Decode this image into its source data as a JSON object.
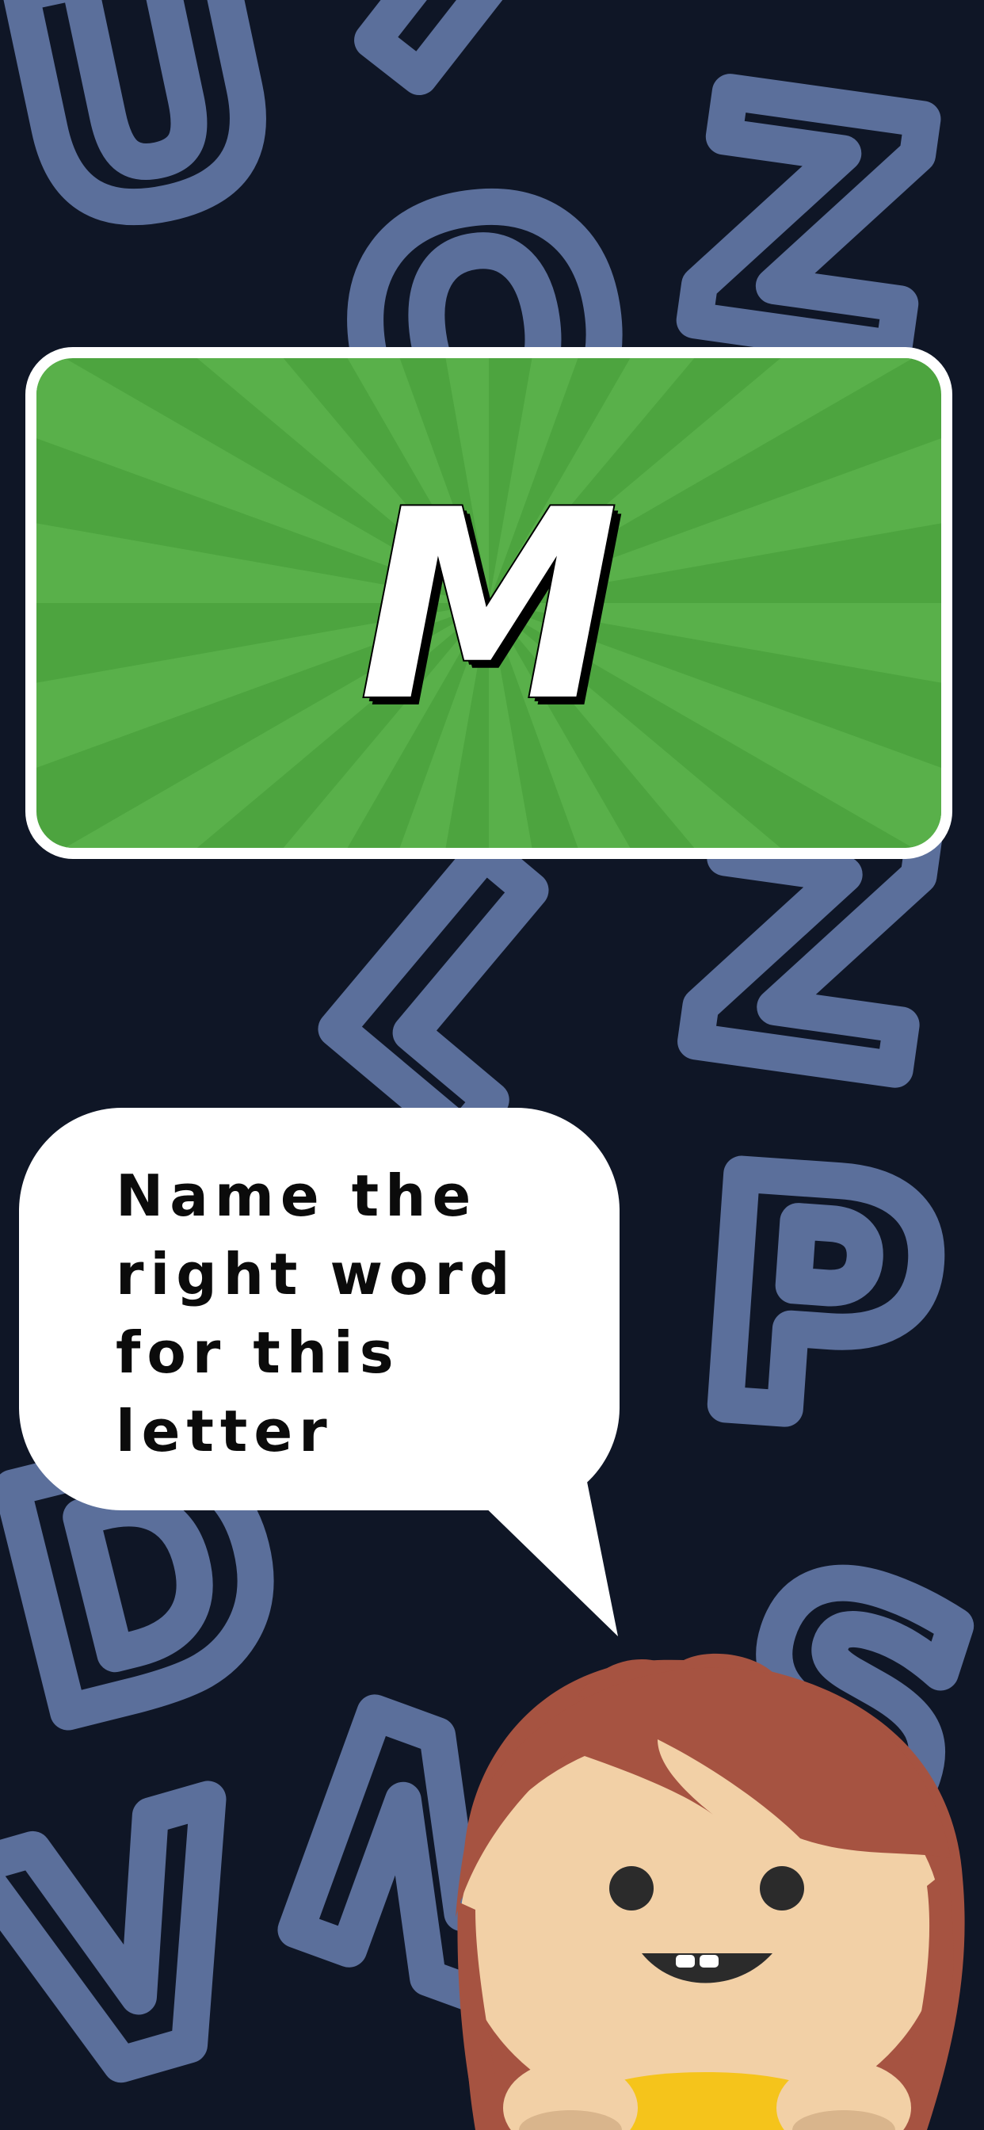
{
  "letter_card": {
    "letter": "M",
    "background_color": "#4da43f",
    "ray_color": "#59b04a",
    "border_color": "#ffffff"
  },
  "prompt": {
    "text": "Name the right word for this letter"
  },
  "background": {
    "color": "#0f1626",
    "letter_color": "#5b6f9b",
    "letters": [
      "U",
      "T",
      "O",
      "Z",
      "Z",
      "P",
      "D",
      "V",
      "N",
      "S",
      "L"
    ]
  },
  "mascot": {
    "icon": "girl-character-icon",
    "hair_color": "#a65341",
    "skin_color": "#f2d0a6",
    "shirt_color": "#f5c41b"
  }
}
